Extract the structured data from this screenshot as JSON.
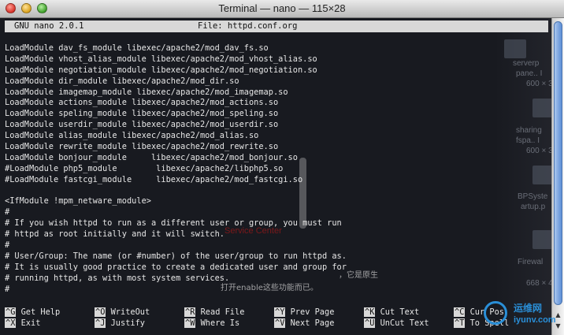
{
  "window": {
    "title": "Terminal — nano — 115×28"
  },
  "nano": {
    "version": "GNU nano 2.0.1",
    "file": "File: httpd.conf.org"
  },
  "lines": [
    "LoadModule dav_fs_module libexec/apache2/mod_dav_fs.so",
    "LoadModule vhost_alias_module libexec/apache2/mod_vhost_alias.so",
    "LoadModule negotiation_module libexec/apache2/mod_negotiation.so",
    "LoadModule dir_module libexec/apache2/mod_dir.so",
    "LoadModule imagemap_module libexec/apache2/mod_imagemap.so",
    "LoadModule actions_module libexec/apache2/mod_actions.so",
    "LoadModule speling_module libexec/apache2/mod_speling.so",
    "LoadModule userdir_module libexec/apache2/mod_userdir.so",
    "LoadModule alias_module libexec/apache2/mod_alias.so",
    "LoadModule rewrite_module libexec/apache2/mod_rewrite.so",
    "LoadModule bonjour_module     libexec/apache2/mod_bonjour.so",
    "#LoadModule php5_module        libexec/apache2/libphp5.so",
    "#LoadModule fastcgi_module     libexec/apache2/mod_fastcgi.so",
    "",
    "<IfModule !mpm_netware_module>",
    "#",
    "# If you wish httpd to run as a different user or group, you must run",
    "# httpd as root initially and it will switch.",
    "#",
    "# User/Group: The name (or #number) of the user/group to run httpd as.",
    "# It is usually good practice to create a dedicated user and group for",
    "# running httpd, as with most system services.",
    "#"
  ],
  "shortcuts": [
    {
      "key": "^G",
      "label": "Get Help"
    },
    {
      "key": "^O",
      "label": "WriteOut"
    },
    {
      "key": "^R",
      "label": "Read File"
    },
    {
      "key": "^Y",
      "label": "Prev Page"
    },
    {
      "key": "^K",
      "label": "Cut Text"
    },
    {
      "key": "^C",
      "label": "Cur Pos"
    },
    {
      "key": "^X",
      "label": "Exit"
    },
    {
      "key": "^J",
      "label": "Justify"
    },
    {
      "key": "^W",
      "label": "Where Is"
    },
    {
      "key": "^V",
      "label": "Next Page"
    },
    {
      "key": "^U",
      "label": "UnCut Text"
    },
    {
      "key": "^T",
      "label": "To Spell"
    }
  ],
  "background": {
    "desktop_items": [
      {
        "name": "serverp",
        "sub": "pane.. I",
        "size": "600 × 3"
      },
      {
        "name": "sharing",
        "sub": "fspa.. I",
        "size": "600 × 3"
      },
      {
        "name": "BPSyste",
        "sub": "artup.p",
        "size": ""
      },
      {
        "name": "Firewal",
        "sub": "",
        "size": "668 × 4"
      }
    ],
    "red_text": "Service Center",
    "cn_text_1": "，它是原生",
    "cn_text_2": "打开enable这些功能而已。"
  },
  "watermark": {
    "top": "运维网",
    "bottom": "iyunv.com"
  },
  "colors": {
    "terminal_bg": "#080a10",
    "text": "#e6e6e6",
    "bar": "#d8d8d8",
    "scroll": "#5d8fd6"
  }
}
